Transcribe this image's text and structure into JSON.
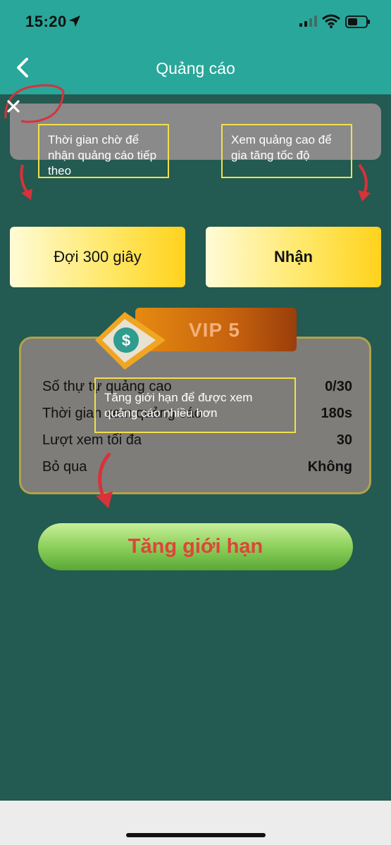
{
  "status_bar": {
    "time": "15:20",
    "icons": [
      "location-arrow-icon",
      "signal-icon",
      "wifi-icon",
      "battery-icon"
    ]
  },
  "header": {
    "title": "Quảng cáo",
    "back_icon": "chevron-left-icon"
  },
  "annotations": {
    "wait_note": "Thời gian chờ để nhận quảng cáo tiếp theo",
    "watch_note": "Xem quảng cao để gia tăng tốc độ",
    "limit_note": "Tăng giới hạn để được xem quảng cáo nhiều hơn"
  },
  "buttons": {
    "wait_label": "Đợi 300 giây",
    "claim_label": "Nhận",
    "increase_limit_label": "Tăng giới hạn"
  },
  "vip": {
    "level_label": "VIP 5",
    "badge_symbol": "$",
    "stats": [
      {
        "label": "Số thự tự quảng cao",
        "value": "0/30"
      },
      {
        "label": "Thời gian xem quảng cáo",
        "value": "180s"
      },
      {
        "label": "Lượt xem tối đa",
        "value": "30"
      },
      {
        "label": "Bỏ qua",
        "value": "Không"
      }
    ]
  },
  "colors": {
    "header_bg": "#28a79a",
    "page_bg": "#235a51",
    "accent_red": "#e0433a",
    "annotation_border": "#f1e04a"
  }
}
